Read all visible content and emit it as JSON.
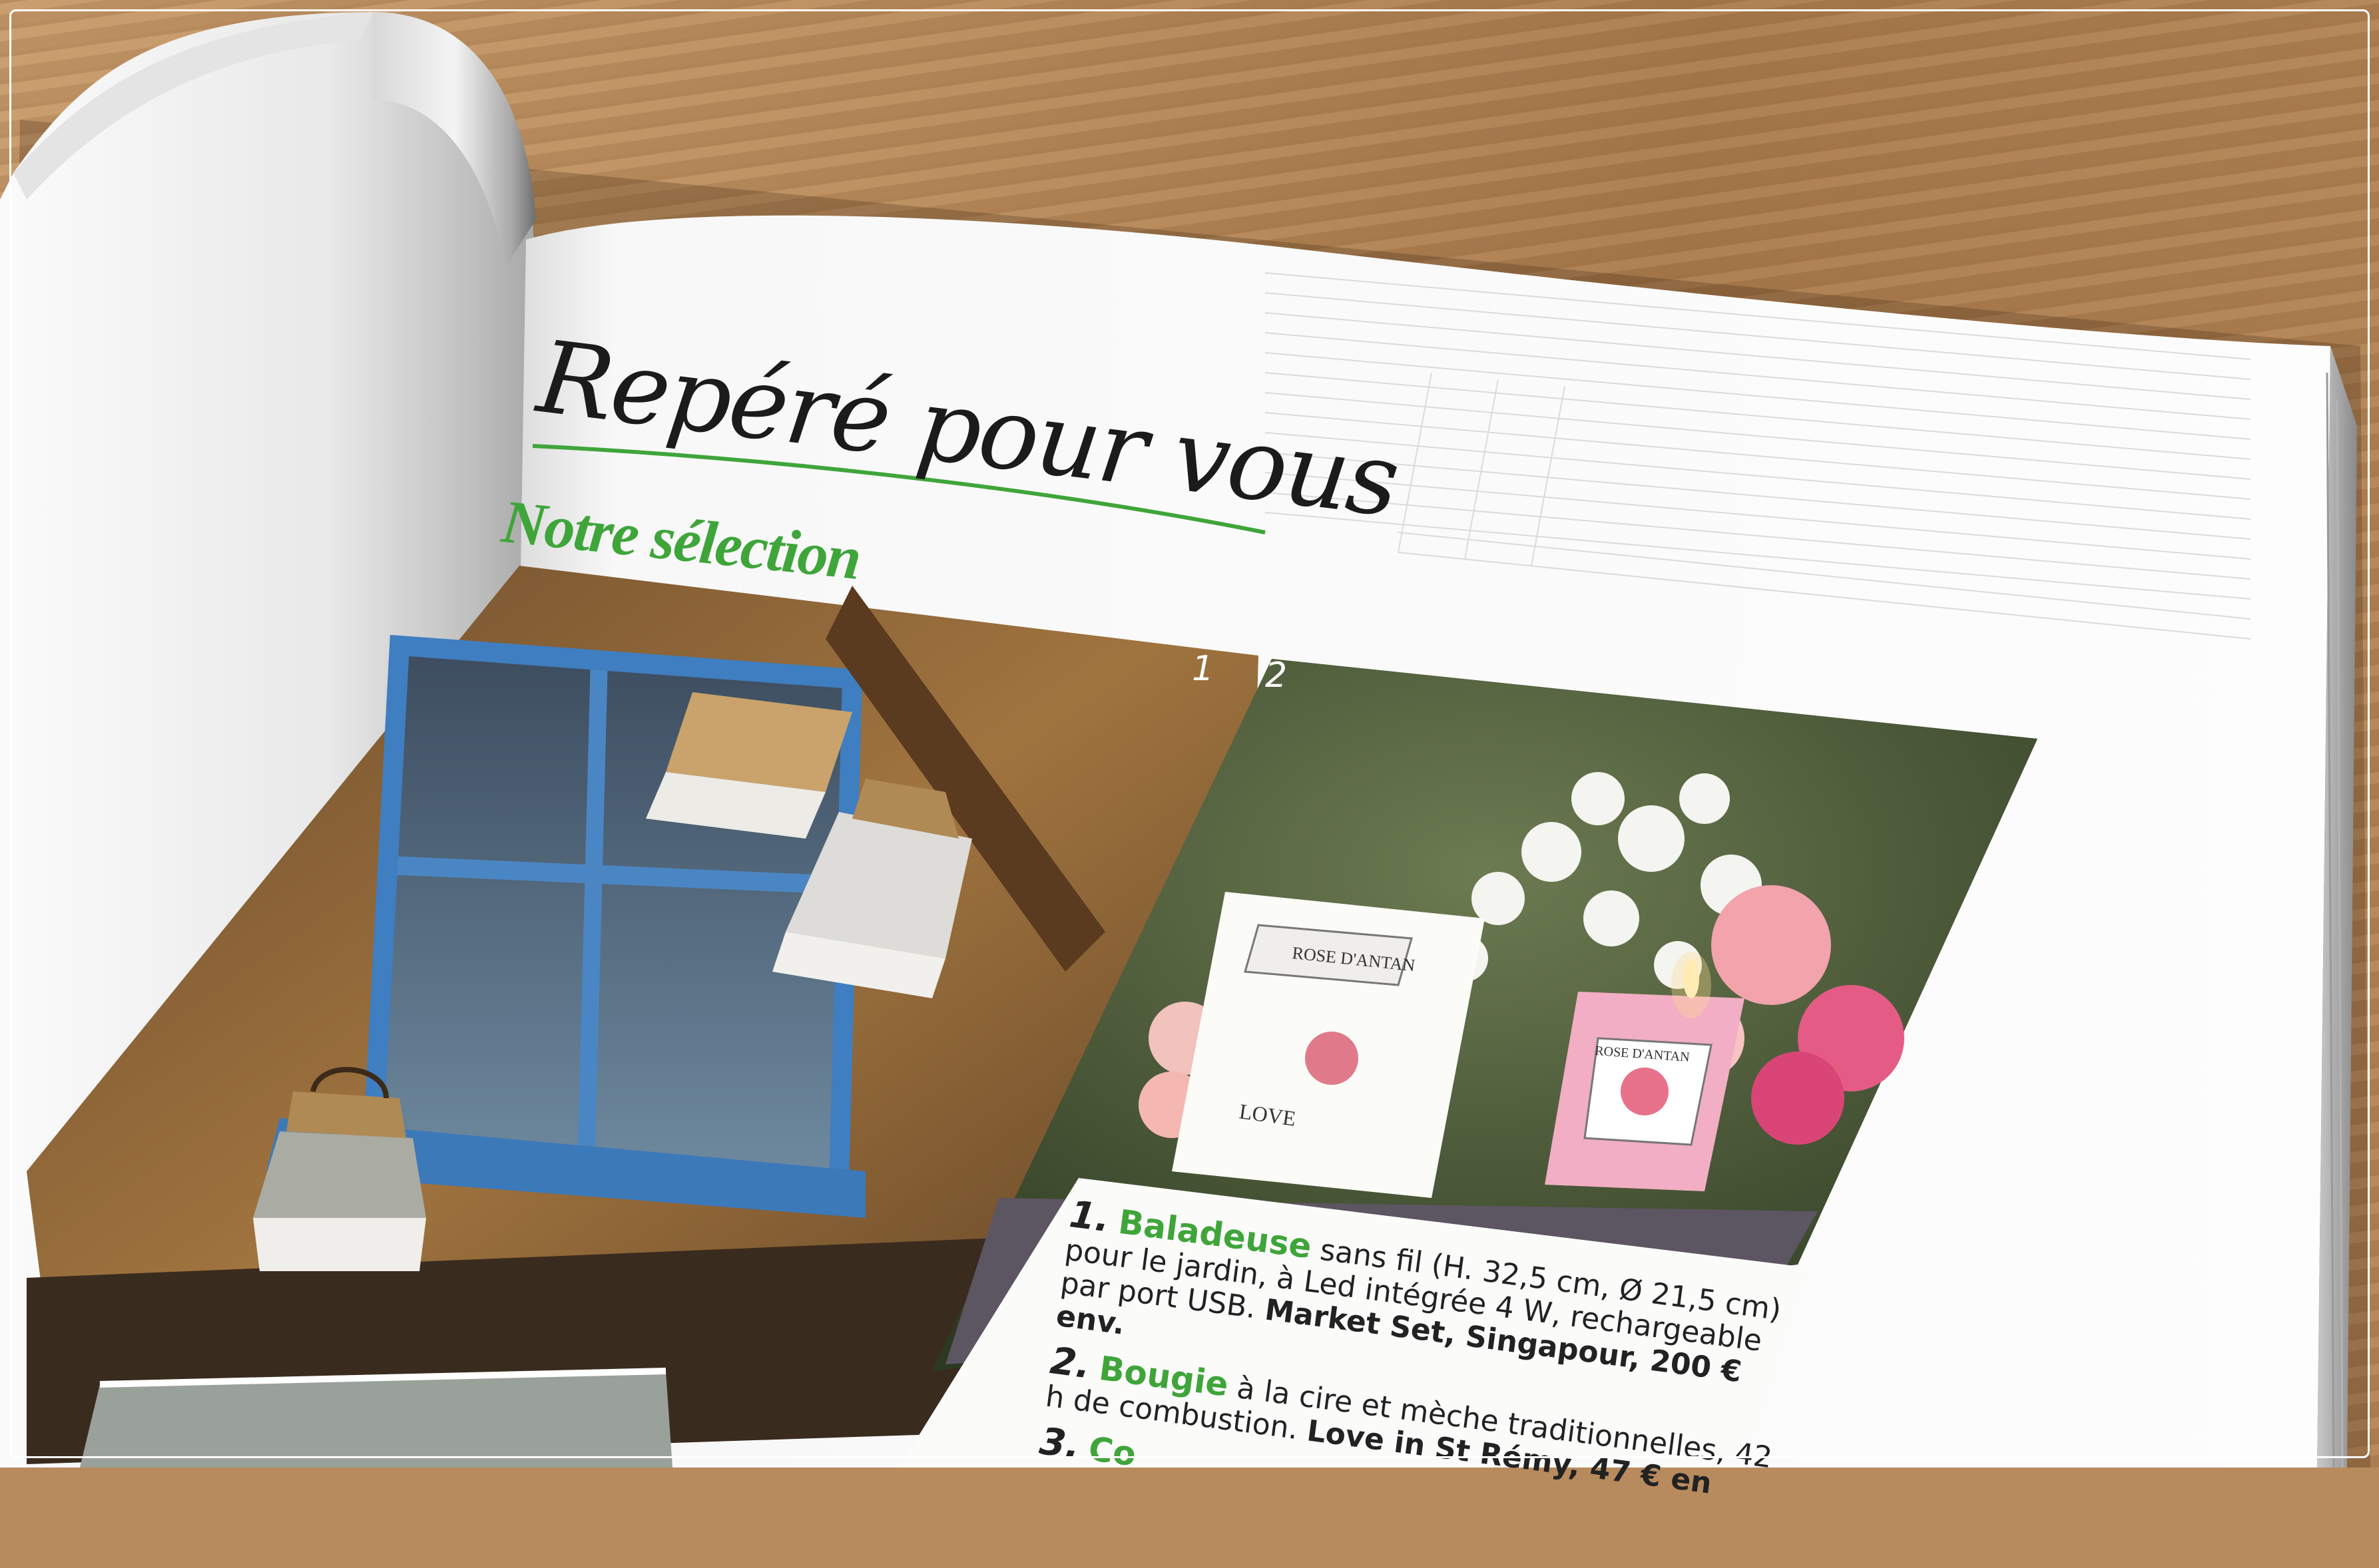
{
  "article": {
    "title": "Repéré pour vous",
    "subtitle": "Notre sélection"
  },
  "photos": {
    "photo1_number": "1",
    "photo2_number": "2",
    "candle_box_brand": "ROSE D'ANTAN",
    "candle_box_love": "LOVE",
    "candle_jar_brand": "ROSE D'ANTAN"
  },
  "items": [
    {
      "number": "1.",
      "name": "Baladeuse",
      "description": " sans fil (H. 32,5 cm, Ø 21,5 cm) pour le jardin, à Led intégrée 4 W, rechargeable par port USB. ",
      "source": "Market Set, Singapour, 200 € env."
    },
    {
      "number": "2.",
      "name": "Bougie",
      "description": " à la cire et mèche traditionnelles, 42 h de combustion. ",
      "source": "Love in St Rémy, 47 € en"
    },
    {
      "number": "3.",
      "name": "Co",
      "description": "",
      "source": ""
    }
  ],
  "colors": {
    "accent_green": "#3fa53a",
    "text_dark": "#1b1b1b",
    "page_white": "#f7f7f5"
  }
}
